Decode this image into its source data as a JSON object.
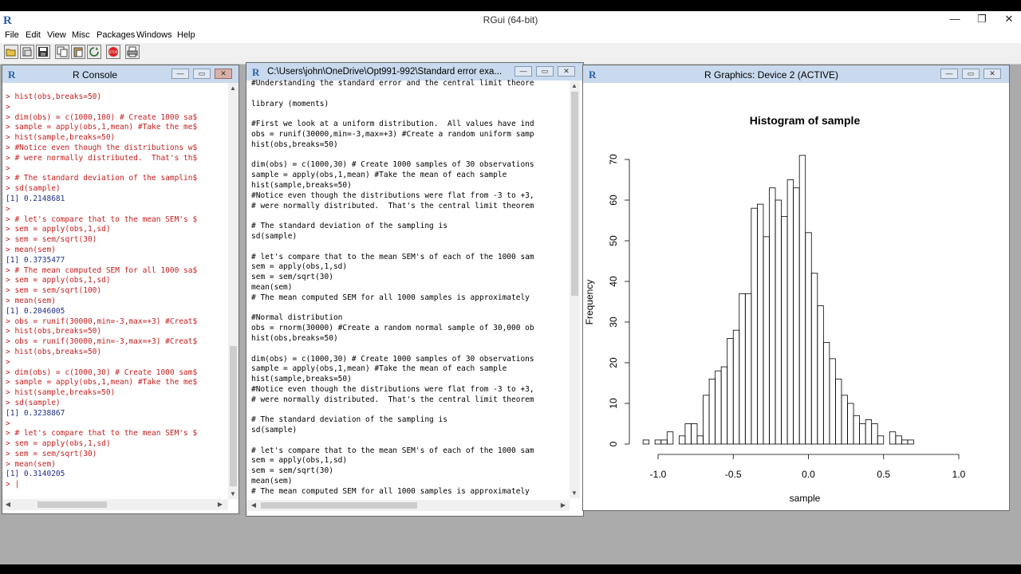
{
  "app": {
    "title": "RGui (64-bit)",
    "window_buttons": [
      "—",
      "❐",
      "✕"
    ],
    "menu": [
      "File",
      "Edit",
      "View",
      "Misc",
      "Packages",
      "Windows",
      "Help"
    ],
    "toolbar_icons": [
      "open-script-icon",
      "load-workspace-icon",
      "save-workspace-icon",
      "copy-icon",
      "paste-icon",
      "copy-paste-icon",
      "stop-icon",
      "print-icon"
    ]
  },
  "console": {
    "title": "R Console",
    "lines": [
      {
        "t": "cmd",
        "s": "> hist(obs,breaks=50)"
      },
      {
        "t": "cmd",
        "s": ">"
      },
      {
        "t": "cmd",
        "s": "> dim(obs) = c(1000,100) # Create 1000 sa$"
      },
      {
        "t": "cmd",
        "s": "> sample = apply(obs,1,mean) #Take the me$"
      },
      {
        "t": "cmd",
        "s": "> hist(sample,breaks=50)"
      },
      {
        "t": "cmd",
        "s": "> #Notice even though the distributions w$"
      },
      {
        "t": "cmd",
        "s": "> # were normally distributed.  That's th$"
      },
      {
        "t": "cmd",
        "s": ">"
      },
      {
        "t": "cmd",
        "s": "> # The standard deviation of the samplin$"
      },
      {
        "t": "cmd",
        "s": "> sd(sample)"
      },
      {
        "t": "out",
        "s": "[1] 0.2148681"
      },
      {
        "t": "cmd",
        "s": ">"
      },
      {
        "t": "cmd",
        "s": "> # let's compare that to the mean SEM's $"
      },
      {
        "t": "cmd",
        "s": "> sem = apply(obs,1,sd)"
      },
      {
        "t": "cmd",
        "s": "> sem = sem/sqrt(30)"
      },
      {
        "t": "cmd",
        "s": "> mean(sem)"
      },
      {
        "t": "out",
        "s": "[1] 0.3735477"
      },
      {
        "t": "cmd",
        "s": "> # The mean computed SEM for all 1000 sa$"
      },
      {
        "t": "cmd",
        "s": "> sem = apply(obs,1,sd)"
      },
      {
        "t": "cmd",
        "s": "> sem = sem/sqrt(100)"
      },
      {
        "t": "cmd",
        "s": "> mean(sem)"
      },
      {
        "t": "out",
        "s": "[1] 0.2046005"
      },
      {
        "t": "cmd",
        "s": "> obs = runif(30000,min=-3,max=+3) #Creat$"
      },
      {
        "t": "cmd",
        "s": "> hist(obs,breaks=50)"
      },
      {
        "t": "cmd",
        "s": "> obs = runif(30000,min=-3,max=+3) #Creat$"
      },
      {
        "t": "cmd",
        "s": "> hist(obs,breaks=50)"
      },
      {
        "t": "cmd",
        "s": ">"
      },
      {
        "t": "cmd",
        "s": "> dim(obs) = c(1000,30) # Create 1000 sam$"
      },
      {
        "t": "cmd",
        "s": "> sample = apply(obs,1,mean) #Take the me$"
      },
      {
        "t": "cmd",
        "s": "> hist(sample,breaks=50)"
      },
      {
        "t": "cmd",
        "s": "> sd(sample)"
      },
      {
        "t": "out",
        "s": "[1] 0.3238867"
      },
      {
        "t": "cmd",
        "s": ">"
      },
      {
        "t": "cmd",
        "s": "> # let's compare that to the mean SEM's $"
      },
      {
        "t": "cmd",
        "s": "> sem = apply(obs,1,sd)"
      },
      {
        "t": "cmd",
        "s": "> sem = sem/sqrt(30)"
      },
      {
        "t": "cmd",
        "s": "> mean(sem)"
      },
      {
        "t": "out",
        "s": "[1] 0.3140205"
      },
      {
        "t": "cmd",
        "s": "> |"
      }
    ]
  },
  "script": {
    "title": "C:\\Users\\john\\OneDrive\\Opt991-992\\Standard error exa...",
    "lines": [
      "#Understanding the standard error and the central limit theore",
      "",
      "library (moments)",
      "",
      "#First we look at a uniform distribution.  All values have ind",
      "obs = runif(30000,min=-3,max=+3) #Create a random uniform samp",
      "hist(obs,breaks=50)",
      "",
      "dim(obs) = c(1000,30) # Create 1000 samples of 30 observations",
      "sample = apply(obs,1,mean) #Take the mean of each sample",
      "hist(sample,breaks=50)",
      "#Notice even though the distributions were flat from -3 to +3,",
      "# were normally distributed.  That's the central limit theorem",
      "",
      "# The standard deviation of the sampling is",
      "sd(sample)",
      "",
      "# let's compare that to the mean SEM's of each of the 1000 sam",
      "sem = apply(obs,1,sd)",
      "sem = sem/sqrt(30)",
      "mean(sem)",
      "# The mean computed SEM for all 1000 samples is approximately",
      "",
      "#Normal distribution",
      "obs = rnorm(30000) #Create a random normal sample of 30,000 ob",
      "hist(obs,breaks=50)",
      "",
      "dim(obs) = c(1000,30) # Create 1000 samples of 30 observations",
      "sample = apply(obs,1,mean) #Take the mean of each sample",
      "hist(sample,breaks=50)",
      "#Notice even though the distributions were flat from -3 to +3,",
      "# were normally distributed.  That's the central limit theorem",
      "",
      "# The standard deviation of the sampling is",
      "sd(sample)",
      "",
      "# let's compare that to the mean SEM's of each of the 1000 sam",
      "sem = apply(obs,1,sd)",
      "sem = sem/sqrt(30)",
      "mean(sem)",
      "# The mean computed SEM for all 1000 samples is approximately"
    ]
  },
  "graphics": {
    "title": "R Graphics: Device 2 (ACTIVE)"
  },
  "chart_data": {
    "type": "bar",
    "title": "Histogram of sample",
    "xlabel": "sample",
    "ylabel": "Frequency",
    "bin_start": -1.1,
    "bin_width": 0.04,
    "values": [
      1,
      0,
      1,
      1,
      3,
      0,
      2,
      5,
      5,
      2,
      12,
      16,
      18,
      19,
      26,
      28,
      37,
      37,
      58,
      59,
      51,
      63,
      60,
      56,
      65,
      63,
      71,
      52,
      42,
      34,
      25,
      21,
      16,
      12,
      10,
      7,
      5,
      6,
      5,
      2,
      0,
      3,
      2,
      1,
      1
    ],
    "xlim": [
      -1.1,
      0.7
    ],
    "x_ticks": [
      "-1.0",
      "-0.5",
      "0.0",
      "0.5",
      "1.0"
    ],
    "x_tick_values": [
      -1.0,
      -0.5,
      0.0,
      0.5,
      1.0
    ],
    "y_ticks": [
      "0",
      "10",
      "20",
      "30",
      "40",
      "50",
      "60",
      "70"
    ],
    "ylim": [
      0,
      70
    ]
  }
}
